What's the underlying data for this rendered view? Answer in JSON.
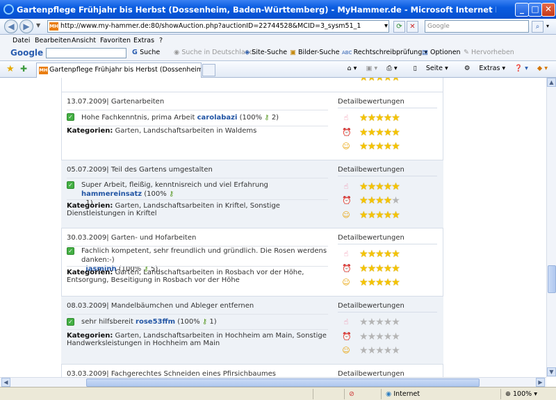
{
  "window": {
    "title": "Gartenpflege Frühjahr bis Herbst (Dossenheim, Baden-Württemberg) - MyHammer.de - Microsoft Internet Explorer bereitgestellt von"
  },
  "address": {
    "url": "http://www.my-hammer.de:80/showAuction.php?auctionID=22744528&MCID=3_sysm51_1",
    "favicon": "MH",
    "search_placeholder": "Google"
  },
  "menu": [
    "Datei",
    "Bearbeiten",
    "Ansicht",
    "Favoriten",
    "Extras",
    "?"
  ],
  "googlebar": {
    "logo": "Google",
    "search": "Suche",
    "search_de": "Suche in Deutschland",
    "site_search": "Site-Suche",
    "image_search": "Bilder-Suche",
    "spellcheck": "Rechtschreibprüfung",
    "options": "Optionen",
    "highlight": "Hervorheben"
  },
  "tabs": {
    "active_label": "Gartenpflege Frühjahr bis Herbst (Dossenheim, Baden...",
    "tools": [
      "Seite",
      "Extras"
    ]
  },
  "colors": {
    "link": "#2255a4",
    "star_on": "#f5c400",
    "star_off": "#b5b5b5",
    "check": "#45b045"
  },
  "entries": [
    {
      "date": "13.07.2009",
      "title": "Gartenarbeiten",
      "detail_label": "Detailbewertungen",
      "comment": "Hohe Fachkenntnis, prima Arbeit",
      "user": "carolabazi",
      "user_stats_open": "(100%",
      "user_stats_close": "2)",
      "categories_label": "Kategorien:",
      "categories": "Garten, Landschaftsarbeiten in Waldems",
      "ratings": [
        5,
        5,
        5
      ]
    },
    {
      "date": "05.07.2009",
      "title": "Teil des Gartens umgestalten",
      "detail_label": "Detailbewertungen",
      "comment": "Super Arbeit, fleißig, kenntnisreich und viel Erfahrung",
      "user": "hammereinsatz",
      "user_stats_open": "(100%",
      "user_stats_close": "1)",
      "categories_label": "Kategorien:",
      "categories": "Garten, Landschaftsarbeiten in Kriftel, Sonstige Dienstleistungen in Kriftel",
      "ratings": [
        5,
        4,
        5
      ]
    },
    {
      "date": "30.03.2009",
      "title": "Garten- und Hofarbeiten",
      "detail_label": "Detailbewertungen",
      "comment": "Fachlich kompetent, sehr freundlich und gründlich. Die Rosen werdens danken:-)",
      "user": "jasminh",
      "user_stats_open": "(100%",
      "user_stats_close": "5)",
      "categories_label": "Kategorien:",
      "categories": "Garten, Landschaftsarbeiten in Rosbach vor der Höhe, Entsorgung, Beseitigung in Rosbach vor der Höhe",
      "ratings": [
        5,
        5,
        5
      ]
    },
    {
      "date": "08.03.2009",
      "title": "Mandelbäumchen und Ableger entfernen",
      "detail_label": "Detailbewertungen",
      "comment": "sehr hilfsbereit",
      "user": "rose53ffm",
      "user_stats_open": "(100%",
      "user_stats_close": "1)",
      "categories_label": "Kategorien:",
      "categories": "Garten, Landschaftsarbeiten in Hochheim am Main, Sonstige Handwerksleistungen in Hochheim am Main",
      "ratings": [
        0,
        0,
        0
      ]
    },
    {
      "date": "03.03.2009",
      "title": "Fachgerechtes Schneiden eines Pfirsichbaumes",
      "detail_label": "Detailbewertungen"
    }
  ],
  "status": {
    "zone": "Internet",
    "zoom": "100%"
  }
}
